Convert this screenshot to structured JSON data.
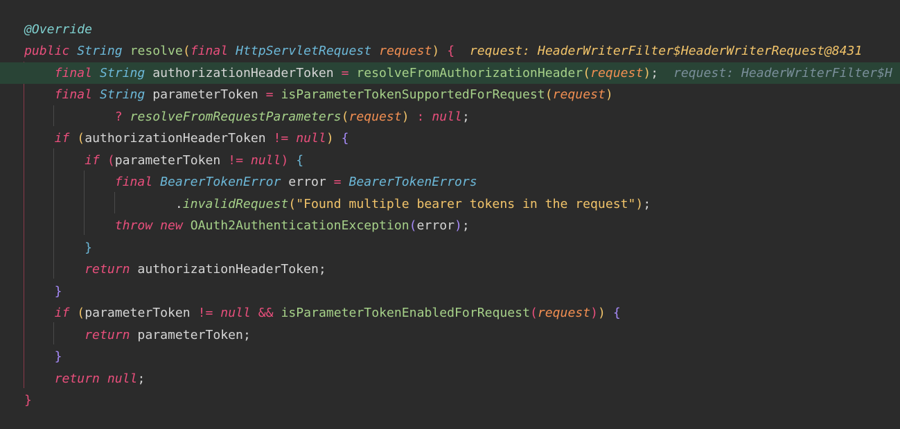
{
  "colors": {
    "background": "#2b2b2b",
    "current_line": "#294436",
    "keyword": "#e94f7c",
    "type": "#6cb8d8",
    "method_decl": "#a6d189",
    "call": "#a6d189",
    "param": "#f28f52",
    "string": "#f2c46a",
    "annotation": "#7fd0cf",
    "inlay": "#f2c46a",
    "inlay_dim": "#7a8f9a",
    "punct": "#d6d6d6",
    "brace_paren": "#f2c46a",
    "brace_if": "#a78bfa"
  },
  "code": {
    "lines": [
      {
        "highlight": false,
        "tokens": [
          {
            "text": "@Override",
            "c": "annotation",
            "i": true
          }
        ]
      },
      {
        "highlight": false,
        "tokens": [
          {
            "text": "public",
            "c": "keyword",
            "i": true
          },
          {
            "text": " ",
            "c": "punct"
          },
          {
            "text": "String",
            "c": "type",
            "i": true
          },
          {
            "text": " ",
            "c": "punct"
          },
          {
            "text": "resolve",
            "c": "method_decl"
          },
          {
            "text": "(",
            "c": "brace_paren"
          },
          {
            "text": "final",
            "c": "keyword",
            "i": true
          },
          {
            "text": " ",
            "c": "punct"
          },
          {
            "text": "HttpServletRequest",
            "c": "type",
            "i": true
          },
          {
            "text": " ",
            "c": "punct"
          },
          {
            "text": "request",
            "c": "param",
            "i": true
          },
          {
            "text": ")",
            "c": "brace_paren"
          },
          {
            "text": " ",
            "c": "punct"
          },
          {
            "text": "{",
            "c": "keyword"
          },
          {
            "text": "  request: HeaderWriterFilter$HeaderWriterRequest@8431",
            "c": "inlay",
            "i": true
          }
        ]
      },
      {
        "highlight": true,
        "tokens": [
          {
            "text": "    ",
            "c": "punct"
          },
          {
            "text": "final",
            "c": "keyword",
            "i": true
          },
          {
            "text": " ",
            "c": "punct"
          },
          {
            "text": "String",
            "c": "type",
            "i": true
          },
          {
            "text": " authorizationHeaderToken ",
            "c": "punct"
          },
          {
            "text": "=",
            "c": "keyword"
          },
          {
            "text": " ",
            "c": "punct"
          },
          {
            "text": "resolveFromAuthorizationHeader",
            "c": "call"
          },
          {
            "text": "(",
            "c": "brace_paren"
          },
          {
            "text": "request",
            "c": "param",
            "i": true
          },
          {
            "text": ")",
            "c": "brace_paren"
          },
          {
            "text": ";",
            "c": "punct"
          },
          {
            "text": "  request: HeaderWriterFilter$H",
            "c": "inlay_dim",
            "i": true
          }
        ]
      },
      {
        "highlight": false,
        "tokens": [
          {
            "text": "    ",
            "c": "punct"
          },
          {
            "text": "final",
            "c": "keyword",
            "i": true
          },
          {
            "text": " ",
            "c": "punct"
          },
          {
            "text": "String",
            "c": "type",
            "i": true
          },
          {
            "text": " parameterToken ",
            "c": "punct"
          },
          {
            "text": "=",
            "c": "keyword"
          },
          {
            "text": " ",
            "c": "punct"
          },
          {
            "text": "isParameterTokenSupportedForRequest",
            "c": "call"
          },
          {
            "text": "(",
            "c": "brace_paren"
          },
          {
            "text": "request",
            "c": "param",
            "i": true
          },
          {
            "text": ")",
            "c": "brace_paren"
          }
        ]
      },
      {
        "highlight": false,
        "tokens": [
          {
            "text": "            ",
            "c": "punct"
          },
          {
            "text": "?",
            "c": "keyword"
          },
          {
            "text": " ",
            "c": "punct"
          },
          {
            "text": "resolveFromRequestParameters",
            "c": "call",
            "i": true
          },
          {
            "text": "(",
            "c": "brace_paren"
          },
          {
            "text": "request",
            "c": "param",
            "i": true
          },
          {
            "text": ")",
            "c": "brace_paren"
          },
          {
            "text": " ",
            "c": "punct"
          },
          {
            "text": ":",
            "c": "keyword"
          },
          {
            "text": " ",
            "c": "punct"
          },
          {
            "text": "null",
            "c": "keyword",
            "i": true
          },
          {
            "text": ";",
            "c": "punct"
          }
        ]
      },
      {
        "highlight": false,
        "tokens": [
          {
            "text": "    ",
            "c": "punct"
          },
          {
            "text": "if",
            "c": "keyword",
            "i": true
          },
          {
            "text": " ",
            "c": "punct"
          },
          {
            "text": "(",
            "c": "brace_paren"
          },
          {
            "text": "authorizationHeaderToken ",
            "c": "punct"
          },
          {
            "text": "!=",
            "c": "keyword"
          },
          {
            "text": " ",
            "c": "punct"
          },
          {
            "text": "null",
            "c": "keyword",
            "i": true
          },
          {
            "text": ")",
            "c": "brace_paren"
          },
          {
            "text": " ",
            "c": "punct"
          },
          {
            "text": "{",
            "c": "brace_if"
          }
        ]
      },
      {
        "highlight": false,
        "tokens": [
          {
            "text": "        ",
            "c": "punct"
          },
          {
            "text": "if",
            "c": "keyword",
            "i": true
          },
          {
            "text": " ",
            "c": "punct"
          },
          {
            "text": "(",
            "c": "keyword"
          },
          {
            "text": "parameterToken ",
            "c": "punct"
          },
          {
            "text": "!=",
            "c": "keyword"
          },
          {
            "text": " ",
            "c": "punct"
          },
          {
            "text": "null",
            "c": "keyword",
            "i": true
          },
          {
            "text": ")",
            "c": "keyword"
          },
          {
            "text": " ",
            "c": "punct"
          },
          {
            "text": "{",
            "c": "type"
          }
        ]
      },
      {
        "highlight": false,
        "tokens": [
          {
            "text": "            ",
            "c": "punct"
          },
          {
            "text": "final",
            "c": "keyword",
            "i": true
          },
          {
            "text": " ",
            "c": "punct"
          },
          {
            "text": "BearerTokenError",
            "c": "type",
            "i": true
          },
          {
            "text": " error ",
            "c": "punct"
          },
          {
            "text": "=",
            "c": "keyword"
          },
          {
            "text": " ",
            "c": "punct"
          },
          {
            "text": "BearerTokenErrors",
            "c": "type",
            "i": true
          }
        ]
      },
      {
        "highlight": false,
        "tokens": [
          {
            "text": "                    ",
            "c": "punct"
          },
          {
            "text": ".",
            "c": "punct"
          },
          {
            "text": "invalidRequest",
            "c": "call",
            "i": true
          },
          {
            "text": "(",
            "c": "brace_paren"
          },
          {
            "text": "\"Found multiple bearer tokens in the request\"",
            "c": "string"
          },
          {
            "text": ")",
            "c": "brace_paren"
          },
          {
            "text": ";",
            "c": "punct"
          }
        ]
      },
      {
        "highlight": false,
        "tokens": [
          {
            "text": "            ",
            "c": "punct"
          },
          {
            "text": "throw",
            "c": "keyword",
            "i": true
          },
          {
            "text": " ",
            "c": "punct"
          },
          {
            "text": "new",
            "c": "keyword",
            "i": true
          },
          {
            "text": " ",
            "c": "punct"
          },
          {
            "text": "OAuth2AuthenticationException",
            "c": "call"
          },
          {
            "text": "(",
            "c": "brace_if"
          },
          {
            "text": "error",
            "c": "punct"
          },
          {
            "text": ")",
            "c": "brace_if"
          },
          {
            "text": ";",
            "c": "punct"
          }
        ]
      },
      {
        "highlight": false,
        "tokens": [
          {
            "text": "        ",
            "c": "punct"
          },
          {
            "text": "}",
            "c": "type"
          }
        ]
      },
      {
        "highlight": false,
        "tokens": [
          {
            "text": "        ",
            "c": "punct"
          },
          {
            "text": "return",
            "c": "keyword",
            "i": true
          },
          {
            "text": " authorizationHeaderToken",
            "c": "punct"
          },
          {
            "text": ";",
            "c": "punct"
          }
        ]
      },
      {
        "highlight": false,
        "tokens": [
          {
            "text": "    ",
            "c": "punct"
          },
          {
            "text": "}",
            "c": "brace_if"
          }
        ]
      },
      {
        "highlight": false,
        "tokens": [
          {
            "text": "    ",
            "c": "punct"
          },
          {
            "text": "if",
            "c": "keyword",
            "i": true
          },
          {
            "text": " ",
            "c": "punct"
          },
          {
            "text": "(",
            "c": "brace_paren"
          },
          {
            "text": "parameterToken ",
            "c": "punct"
          },
          {
            "text": "!=",
            "c": "keyword"
          },
          {
            "text": " ",
            "c": "punct"
          },
          {
            "text": "null",
            "c": "keyword",
            "i": true
          },
          {
            "text": " ",
            "c": "punct"
          },
          {
            "text": "&&",
            "c": "keyword"
          },
          {
            "text": " ",
            "c": "punct"
          },
          {
            "text": "isParameterTokenEnabledForRequest",
            "c": "call"
          },
          {
            "text": "(",
            "c": "keyword"
          },
          {
            "text": "request",
            "c": "param",
            "i": true
          },
          {
            "text": ")",
            "c": "keyword"
          },
          {
            "text": ")",
            "c": "brace_paren"
          },
          {
            "text": " ",
            "c": "punct"
          },
          {
            "text": "{",
            "c": "brace_if"
          }
        ]
      },
      {
        "highlight": false,
        "tokens": [
          {
            "text": "        ",
            "c": "punct"
          },
          {
            "text": "return",
            "c": "keyword",
            "i": true
          },
          {
            "text": " parameterToken",
            "c": "punct"
          },
          {
            "text": ";",
            "c": "punct"
          }
        ]
      },
      {
        "highlight": false,
        "tokens": [
          {
            "text": "    ",
            "c": "punct"
          },
          {
            "text": "}",
            "c": "brace_if"
          }
        ]
      },
      {
        "highlight": false,
        "tokens": [
          {
            "text": "    ",
            "c": "punct"
          },
          {
            "text": "return",
            "c": "keyword",
            "i": true
          },
          {
            "text": " ",
            "c": "punct"
          },
          {
            "text": "null",
            "c": "keyword",
            "i": true
          },
          {
            "text": ";",
            "c": "punct"
          }
        ]
      },
      {
        "highlight": false,
        "tokens": [
          {
            "text": "}",
            "c": "keyword"
          }
        ]
      }
    ]
  }
}
